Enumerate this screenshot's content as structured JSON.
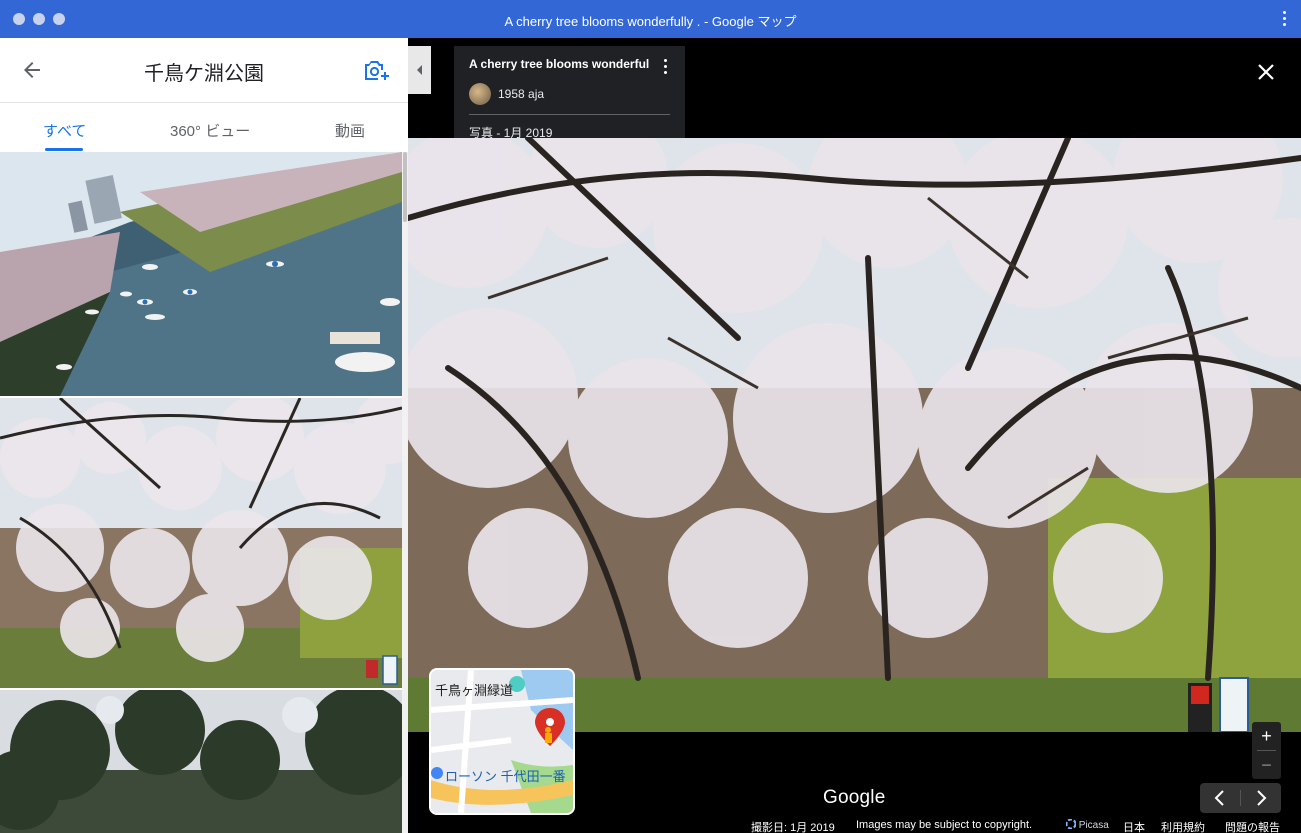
{
  "window": {
    "title": "A cherry tree blooms wonderfully . - Google マップ"
  },
  "sidebar": {
    "place_title": "千鳥ケ淵公園",
    "tabs": [
      {
        "label": "すべて",
        "active": true
      },
      {
        "label": "360° ビュー",
        "active": false
      },
      {
        "label": "動画",
        "active": false
      }
    ],
    "icons": {
      "back": "arrow-left-icon",
      "add_photo": "add-photo-icon"
    }
  },
  "viewer": {
    "info": {
      "title": "A cherry tree blooms wonderfully .",
      "author": "1958 aja",
      "date": "写真 - 1月 2019"
    },
    "minimap": {
      "label_top": "千鳥ヶ淵緑道",
      "label_bottom": "ローソン 千代田一番"
    },
    "zoom_in": "+",
    "zoom_out": "−",
    "logo": "Google",
    "footer": {
      "capture_date": "撮影日: 1月 2019",
      "copyright": "Images may be subject to copyright.",
      "picasa": "Picasa",
      "country": "日本",
      "terms": "利用規約",
      "report": "問題の報告"
    }
  },
  "colors": {
    "accent": "#1a73e8",
    "titlebar": "#3367d6"
  }
}
